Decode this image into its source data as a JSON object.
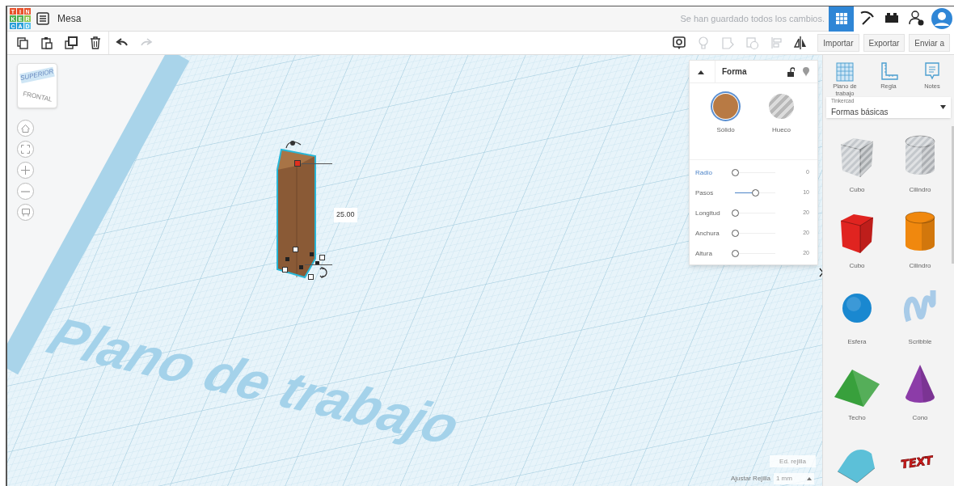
{
  "header": {
    "logo": [
      "T",
      "I",
      "N",
      "K",
      "E",
      "R",
      "C",
      "A",
      "D"
    ],
    "project_title": "Mesa",
    "save_status": "Se han guardado todos los cambios.",
    "nav": [
      {
        "kind": "grid",
        "selected": true
      },
      {
        "kind": "pickaxe",
        "selected": false
      },
      {
        "kind": "bricks",
        "selected": false
      },
      {
        "kind": "user-add",
        "selected": false
      },
      {
        "kind": "avatar",
        "selected": false
      }
    ]
  },
  "toolbar": {
    "edit_tools": [
      {
        "kind": "copy",
        "disabled": false
      },
      {
        "kind": "paste",
        "disabled": false
      },
      {
        "kind": "duplicate",
        "disabled": false
      },
      {
        "kind": "delete",
        "disabled": false
      },
      {
        "kind": "undo",
        "disabled": false
      },
      {
        "kind": "redo",
        "disabled": true
      }
    ],
    "view_tools": [
      {
        "kind": "note",
        "disabled": false
      },
      {
        "kind": "light",
        "disabled": true
      },
      {
        "kind": "group",
        "disabled": true
      },
      {
        "kind": "ungroup",
        "disabled": true
      },
      {
        "kind": "align",
        "disabled": true
      },
      {
        "kind": "mirror",
        "disabled": false
      }
    ],
    "buttons": [
      "Importar",
      "Exportar",
      "Enviar a"
    ]
  },
  "view_cube": {
    "top": "SUPERIOR",
    "front": "FRONTAL"
  },
  "view_controls": [
    {
      "kind": "home"
    },
    {
      "kind": "fit"
    },
    {
      "kind": "zoom-in"
    },
    {
      "kind": "zoom-out"
    },
    {
      "kind": "perspective"
    }
  ],
  "workplane": {
    "label": "Plano de trabajo",
    "dimension": "25.00"
  },
  "shape_panel": {
    "title": "Forma",
    "expanded": true,
    "locked": false,
    "modes": [
      {
        "label": "Sólido",
        "selected": true
      },
      {
        "label": "Hueco",
        "selected": false
      }
    ],
    "params": [
      {
        "label": "Radio",
        "active": true,
        "level": 0,
        "value": "0"
      },
      {
        "label": "Pasos",
        "active": false,
        "level": 0.5,
        "value": "10"
      },
      {
        "label": "Longitud",
        "active": false,
        "level": 0,
        "value": "20"
      },
      {
        "label": "Anchura",
        "active": false,
        "level": 0,
        "value": "20"
      },
      {
        "label": "Altura",
        "active": false,
        "level": 0,
        "value": "20"
      }
    ]
  },
  "grid_settings": {
    "edit_button": "Ed. rejilla",
    "snap_label": "Ajustar Rejilla",
    "snap_value": "1 mm"
  },
  "sidebar": {
    "tools": [
      {
        "kind": "workplane",
        "label": "Plano de trabajo"
      },
      {
        "kind": "ruler",
        "label": "Regla"
      },
      {
        "kind": "notes",
        "label": "Notes"
      }
    ],
    "library": {
      "source": "Tinkercad",
      "category": "Formas básicas"
    },
    "shapes": [
      {
        "label": "Cubo",
        "kind": "box",
        "hole": true,
        "color": "#c4c8cc"
      },
      {
        "label": "Cilindro",
        "kind": "cylinder",
        "hole": true,
        "color": "#c4c8cc"
      },
      {
        "label": "Cubo",
        "kind": "box",
        "hole": false,
        "color": "#e02420"
      },
      {
        "label": "Cilindro",
        "kind": "cylinder",
        "hole": false,
        "color": "#f0880e"
      },
      {
        "label": "Esfera",
        "kind": "sphere",
        "hole": false,
        "color": "#1a88d0"
      },
      {
        "label": "Scribble",
        "kind": "scribble",
        "hole": false,
        "color": "#a8cbe8"
      },
      {
        "label": "Techo",
        "kind": "roof",
        "hole": false,
        "color": "#38a03c"
      },
      {
        "label": "Cono",
        "kind": "cone",
        "hole": false,
        "color": "#8c3ca8"
      },
      {
        "kind": "halfcylinder",
        "hole": false,
        "color": "#5cc0d8"
      },
      {
        "kind": "text",
        "hole": false,
        "color": "#d41c1c",
        "glyph": "TEXT"
      }
    ]
  }
}
